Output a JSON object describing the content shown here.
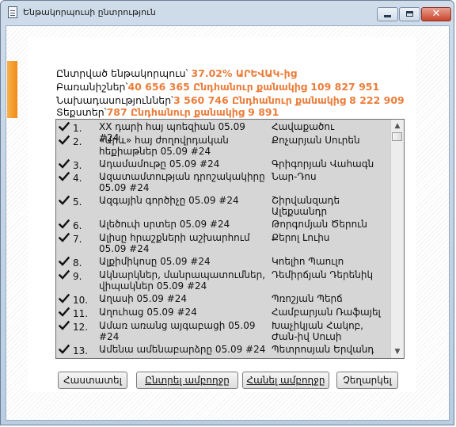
{
  "window": {
    "title": "Ենթակորպուսի ընտրություն",
    "icon": "document-icon",
    "controls": {
      "minimize": "minimize-icon",
      "maximize": "maximize-icon",
      "close": "close-icon"
    },
    "close_glyph": "✕"
  },
  "summary": {
    "selected_label": "Ընտրված ենթակորպուս՝ ",
    "selected_value": "37.02% ԱՐԵՎԱԿ-ից",
    "words_label": "Բառանիշներ՝",
    "words_value": "40 656 365 Ընդհանուր քանակից 109 827 951",
    "sentences_label": "Նախադասություններ՝",
    "sentences_value": "3 560 746 Ընդհանուր քանակից 8 222 909",
    "texts_label": "Տեքստեր՝",
    "texts_value": "787 Ընդհանուր քանակից 9 891"
  },
  "list": {
    "check_icon": "checkmark-icon",
    "items": [
      {
        "num": "1.",
        "title": "XX դարի հայ պոեզիան 05.09 #24",
        "author": "Հավաքածու",
        "checked": true
      },
      {
        "num": "2.",
        "title": "«Արև» հայ ժողովրդական հեքիաթներ 05.09 #24",
        "author": "Քոչարյան Սուրեն",
        "checked": true
      },
      {
        "num": "3.",
        "title": "Ադամամութը 05.09 #24",
        "author": "Գրիգորյան Վահագն",
        "checked": true
      },
      {
        "num": "4.",
        "title": "Ազատամտության դրոշակակիրը 05.09 #24",
        "author": "Նար-Դոս",
        "checked": true
      },
      {
        "num": "5.",
        "title": "Ազգային գործիչը 05.09 #24",
        "author": "Շիրվանզադե Ալեքսանդր",
        "checked": true
      },
      {
        "num": "6.",
        "title": "Ալեծուփ սրտեր 05.09 #24",
        "author": "Թորգոմյան Ծերուն",
        "checked": true
      },
      {
        "num": "7.",
        "title": "Ալիսը հրաշքների աշխարհում 05.09 #24",
        "author": "Քերոլ Լուիս",
        "checked": true
      },
      {
        "num": "8.",
        "title": "Ալքիմիկոսը 05.09 #24",
        "author": "Կոելիո Պաուլո",
        "checked": true
      },
      {
        "num": "9.",
        "title": "Ակնարկներ, մանրապատումներ, վիպակներ 05.09 #24",
        "author": "Դեմիրճյան Դերենիկ",
        "checked": true
      },
      {
        "num": "10.",
        "title": "Աղասի 05.09 #24",
        "author": "Պռոշյան Պերճ",
        "checked": true
      },
      {
        "num": "11.",
        "title": "Աղուհաց 05.09 #24",
        "author": "Համբարյան Ռաֆայել",
        "checked": true
      },
      {
        "num": "12.",
        "title": "Ամառ առանց այգաբացի 05.09 #24",
        "author": "Խաչիկյան Հակոբ, Ժան-իվ Սուսի",
        "checked": true
      },
      {
        "num": "13.",
        "title": "Ամենա ամենաբարձրը 05.09 #24",
        "author": "Պետրոսյան Երվանդ",
        "checked": true
      }
    ],
    "scroll_up_glyph": "▲",
    "scroll_down_glyph": "▼"
  },
  "buttons": {
    "confirm": "Հաստատել",
    "select_all": "Ընտրել ամբողջը",
    "deselect_all": "Հանել ամբողջը",
    "cancel": "Չեղարկել"
  }
}
